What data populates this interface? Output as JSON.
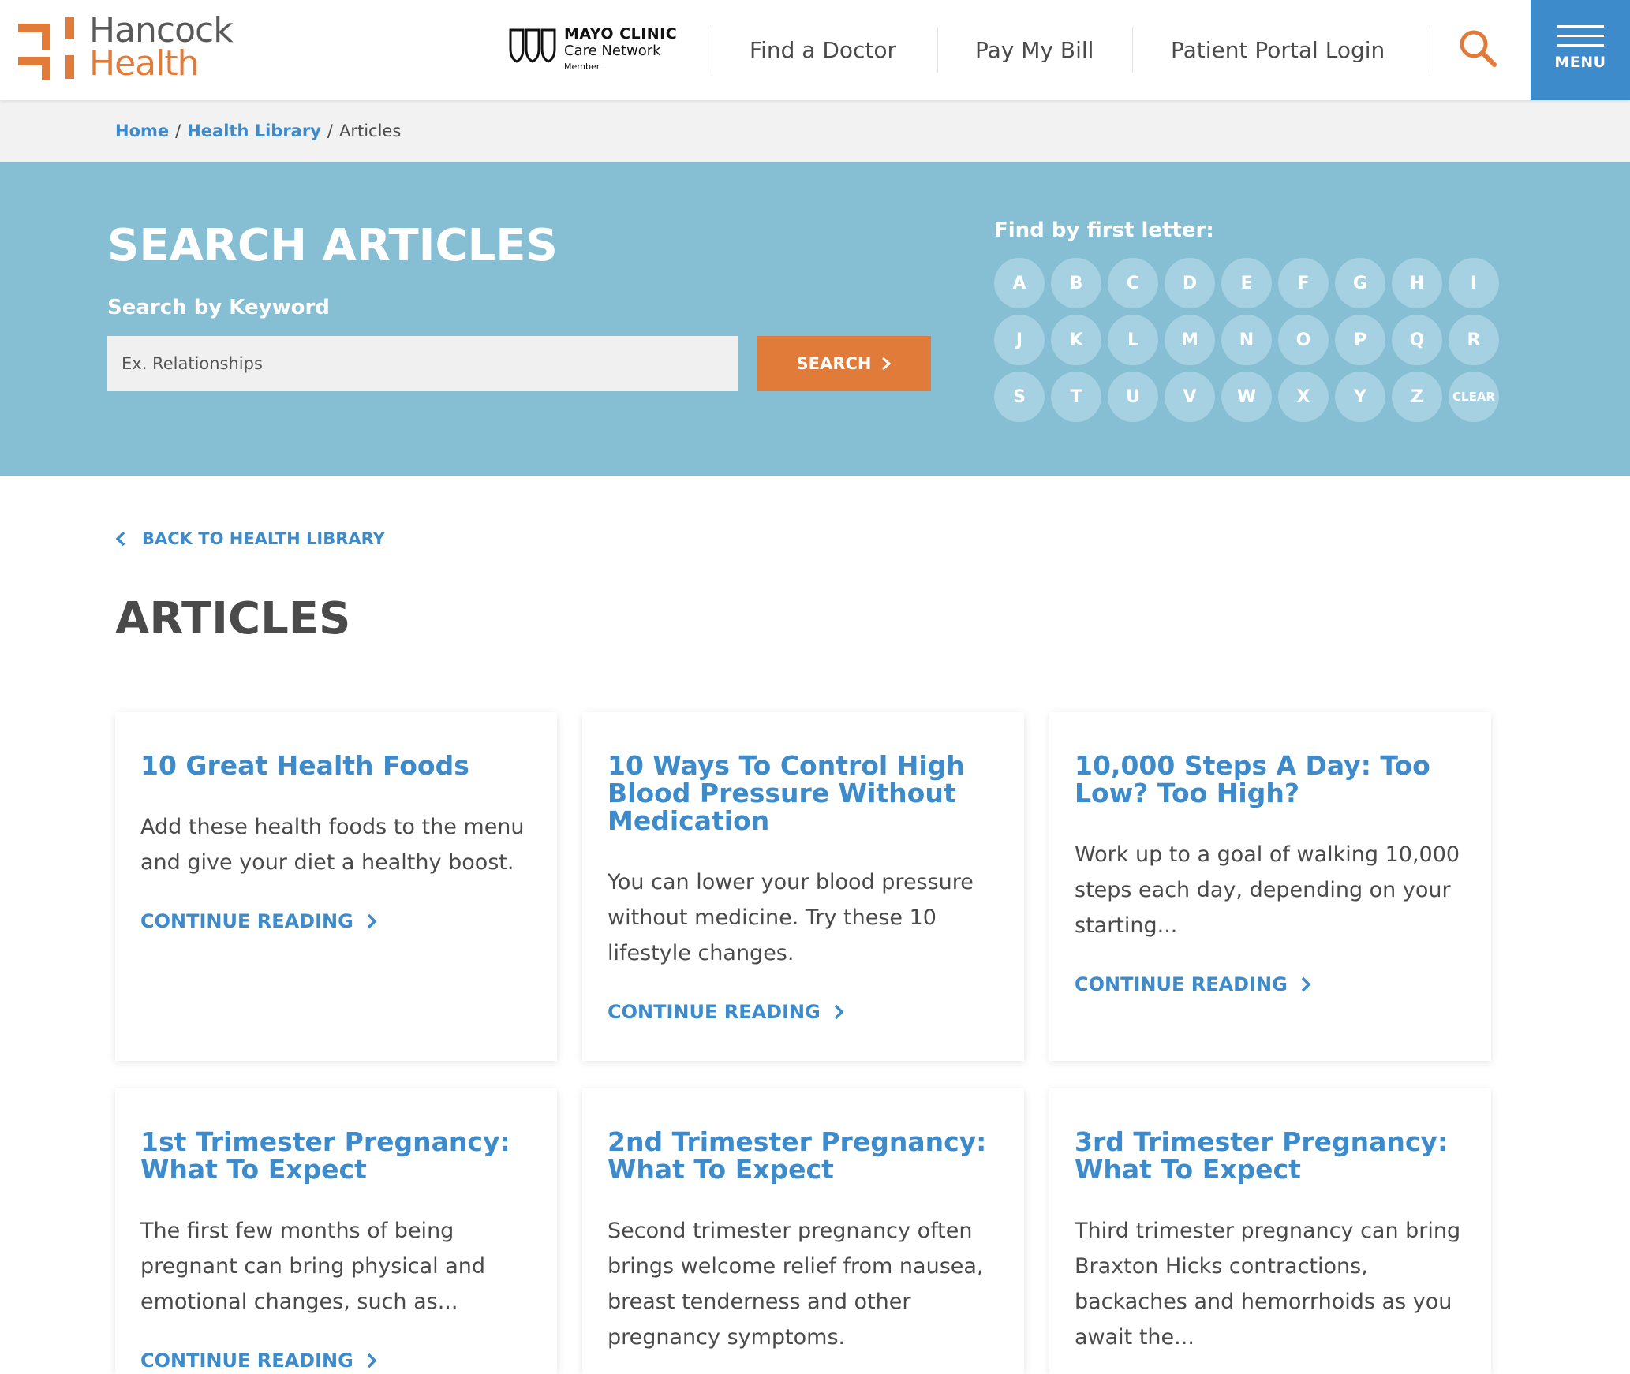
{
  "header": {
    "logo": {
      "line1": "Hancock",
      "line2": "Health"
    },
    "mayo": {
      "line1": "MAYO CLINIC",
      "line2": "Care Network",
      "line3": "Member"
    },
    "nav": [
      "Find a Doctor",
      "Pay My Bill",
      "Patient Portal Login"
    ],
    "menu_label": "MENU"
  },
  "breadcrumb": {
    "home": "Home",
    "library": "Health Library",
    "current": "Articles",
    "separator": "/"
  },
  "search": {
    "title": "SEARCH ARTICLES",
    "keyword_label": "Search by Keyword",
    "placeholder": "Ex. Relationships",
    "button_label": "SEARCH",
    "letters_label": "Find by first letter:",
    "letters": [
      "A",
      "B",
      "C",
      "D",
      "E",
      "F",
      "G",
      "H",
      "I",
      "J",
      "K",
      "L",
      "M",
      "N",
      "O",
      "P",
      "Q",
      "R",
      "S",
      "T",
      "U",
      "V",
      "W",
      "X",
      "Y",
      "Z",
      "CLEAR"
    ]
  },
  "main": {
    "back_label": "BACK TO HEALTH LIBRARY",
    "title": "ARTICLES",
    "cards": [
      {
        "title": "10 Great Health Foods",
        "desc": "Add these health foods to the menu and give your diet a healthy boost.",
        "link": "CONTINUE READING"
      },
      {
        "title": "10 Ways To Control High Blood Pressure Without Medication",
        "desc": "You can lower your blood pressure without medicine. Try these 10 lifestyle changes.",
        "link": "CONTINUE READING"
      },
      {
        "title": "10,000 Steps A Day: Too Low? Too High?",
        "desc": "Work up to a goal of walking 10,000 steps each day, depending on your starting...",
        "link": "CONTINUE READING"
      },
      {
        "title": "1st Trimester Pregnancy: What To Expect",
        "desc": "The first few months of being pregnant can bring physical and emotional changes, such as...",
        "link": "CONTINUE READING"
      },
      {
        "title": "2nd Trimester Pregnancy: What To Expect",
        "desc": "Second trimester pregnancy often brings welcome relief from nausea, breast tenderness and other pregnancy symptoms.",
        "link": ""
      },
      {
        "title": "3rd Trimester Pregnancy: What To Expect",
        "desc": "Third trimester pregnancy can bring Braxton Hicks contractions, backaches and hemorrhoids as you await the...",
        "link": ""
      }
    ]
  },
  "colors": {
    "brand_orange": "#e07b39",
    "brand_blue": "#3d8bcb",
    "band": "#86bfd4"
  }
}
